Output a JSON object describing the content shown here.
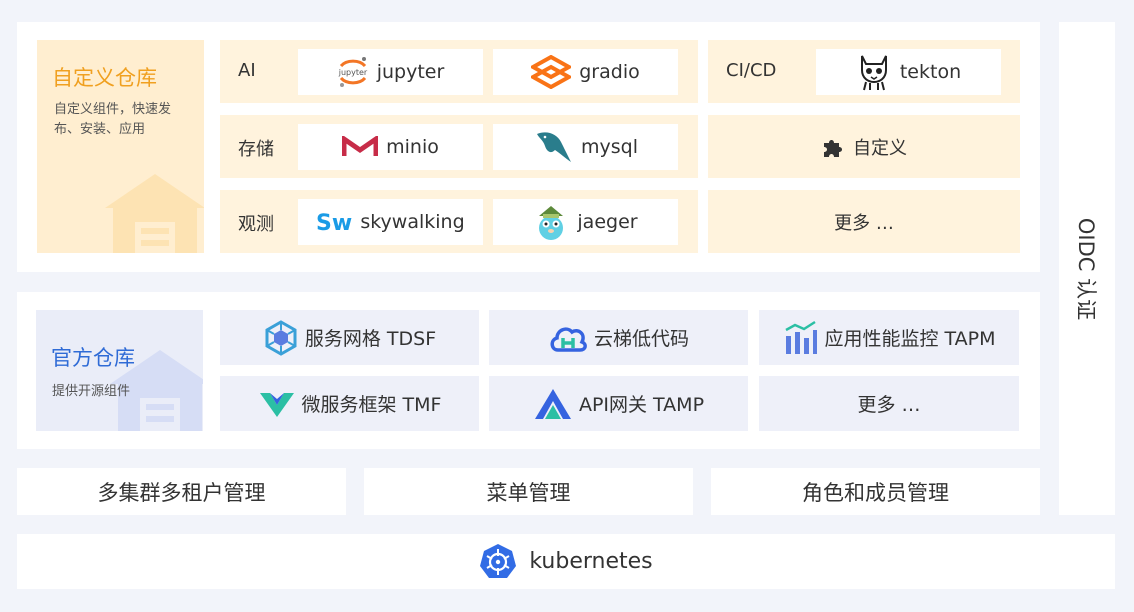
{
  "custom_repo": {
    "title": "自定义仓库",
    "description": "自定义组件，快速发布、安装、应用",
    "rows": [
      {
        "label": "AI",
        "items": [
          "jupyter",
          "gradio"
        ]
      },
      {
        "label": "存储",
        "items": [
          "minio",
          "mysql"
        ]
      },
      {
        "label": "观测",
        "items": [
          "skywalking",
          "jaeger"
        ]
      }
    ],
    "cicd": {
      "label": "CI/CD",
      "item": "tekton"
    },
    "custom_item": "自定义",
    "more": "更多 …"
  },
  "official_repo": {
    "title": "官方仓库",
    "description": "提供开源组件",
    "items": [
      {
        "label": "服务网格 TDSF",
        "icon": "service-mesh-icon"
      },
      {
        "label": "云梯低代码",
        "icon": "lowcode-cloud-icon"
      },
      {
        "label": "应用性能监控 TAPM",
        "icon": "apm-chart-icon"
      },
      {
        "label": "微服务框架 TMF",
        "icon": "tmf-logo-icon"
      },
      {
        "label": "API网关 TAMP",
        "icon": "api-gateway-icon"
      }
    ],
    "more": "更多 …"
  },
  "management": [
    "多集群多租户管理",
    "菜单管理",
    "角色和成员管理"
  ],
  "oidc": "OIDC 认证",
  "base": "kubernetes",
  "colors": {
    "accent_orange": "#f0a020",
    "accent_blue": "#2f6bd6",
    "cream": "#fff3dd",
    "page_bg": "#f2f4fa"
  }
}
